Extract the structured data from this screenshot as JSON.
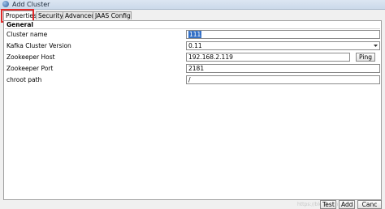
{
  "window": {
    "title": "Add Cluster"
  },
  "tabs": [
    {
      "label": "Properties",
      "active": true
    },
    {
      "label": "Security",
      "active": false
    },
    {
      "label": "Advanced",
      "active": false
    },
    {
      "label": "JAAS Config",
      "active": false
    }
  ],
  "general": {
    "group_label": "General",
    "cluster_name": {
      "label": "Cluster name",
      "value": "111"
    },
    "kafka_version": {
      "label": "Kafka Cluster Version",
      "value": "0.11"
    },
    "zookeeper_host": {
      "label": "Zookeeper Host",
      "value": "192.168.2.119"
    },
    "zookeeper_port": {
      "label": "Zookeeper Port",
      "value": "2181"
    },
    "chroot_path": {
      "label": "chroot path",
      "value": "/"
    },
    "ping_label": "Ping"
  },
  "footer": {
    "test_label": "Test",
    "add_label": "Add",
    "cancel_label": "Canc",
    "watermark": "https://blog.csdn.net/..."
  },
  "colors": {
    "selection": "#3470c6",
    "highlight_box": "#e02a2a"
  },
  "icons": [
    "app-icon",
    "chevron-down-icon"
  ]
}
